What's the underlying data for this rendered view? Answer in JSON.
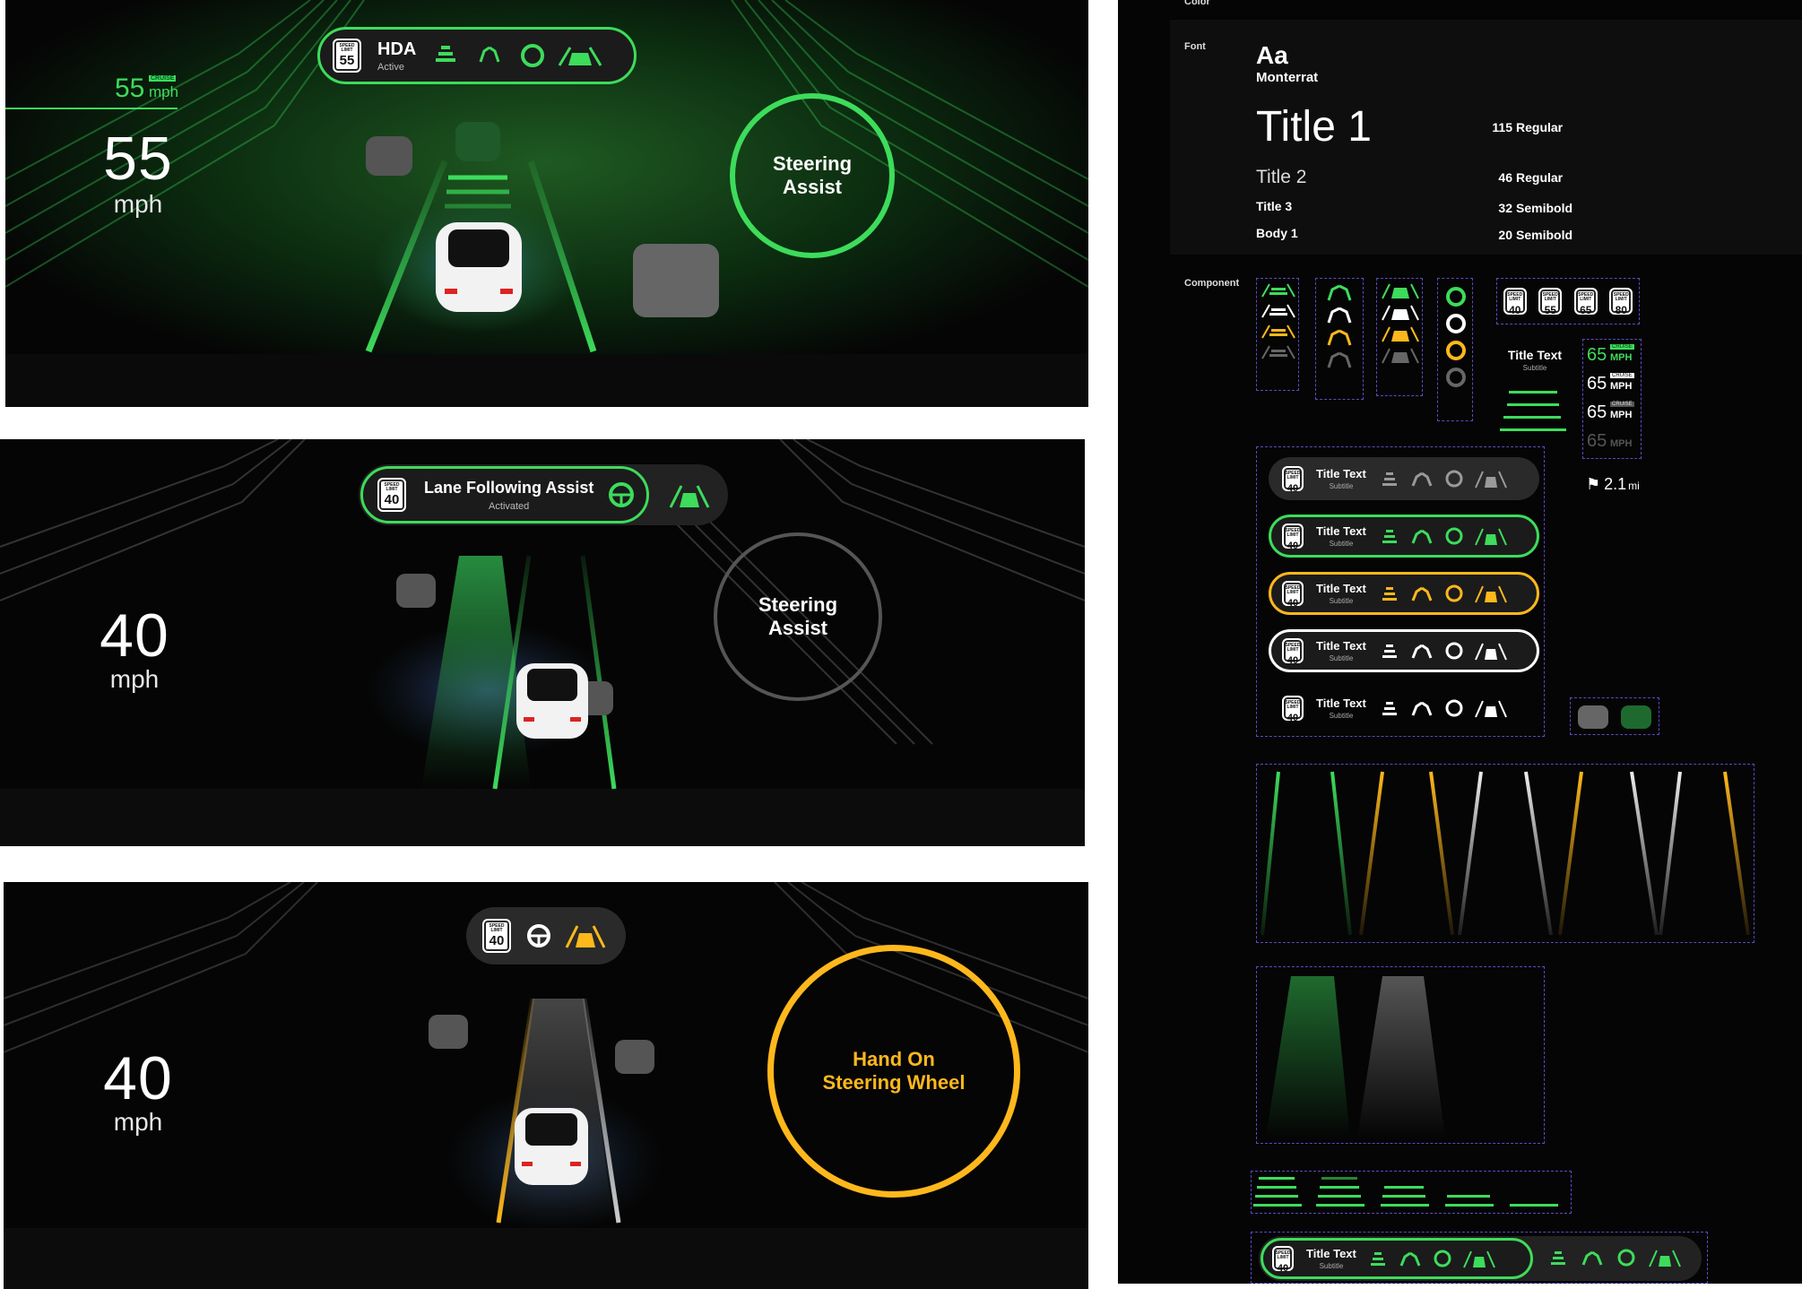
{
  "panel1": {
    "cruise_value": "55",
    "cruise_badge": "CRUISE",
    "cruise_unit": "mph",
    "speed": "55",
    "unit": "mph",
    "hda_title": "HDA",
    "hda_subtitle": "Active",
    "limit_label": "SPEED LIMIT",
    "limit": "55",
    "assist_line1": "Steering",
    "assist_line2": "Assist",
    "accent": "#3ddc5b"
  },
  "panel2": {
    "speed": "40",
    "unit": "mph",
    "limit_label": "SPEED LIMIT",
    "limit": "40",
    "pill_title": "Lane Following Assist",
    "pill_subtitle": "Activated",
    "assist_line1": "Steering",
    "assist_line2": "Assist",
    "accent": "#3ddc5b",
    "ring": "#555555"
  },
  "panel3": {
    "speed": "40",
    "unit": "mph",
    "limit_label": "SPEED LIMIT",
    "limit": "40",
    "warn_line1": "Hand On",
    "warn_line2": "Steering Wheel",
    "warn_color": "#ffb81c"
  },
  "guide": {
    "color_label": "Color",
    "font_label": "Font",
    "font_sample": "Aa",
    "font_name": "Monterrat",
    "type_scale": [
      {
        "name": "Title 1",
        "size": "115",
        "weight": "Regular"
      },
      {
        "name": "Title 2",
        "size": "46",
        "weight": "Regular"
      },
      {
        "name": "Title 3",
        "size": "32",
        "weight": "Semibold"
      },
      {
        "name": "Body 1",
        "size": "20",
        "weight": "Semibold"
      }
    ],
    "component_label": "Component",
    "signs": [
      "40",
      "55",
      "65",
      "80"
    ],
    "sign_label": "SPEED LIMIT",
    "title_text": "Title Text",
    "subtitle_text": "Subtitle",
    "speed_rows": [
      {
        "value": "65",
        "unit": "MPH",
        "badge": "CRUISE"
      },
      {
        "value": "65",
        "unit": "MPH",
        "badge": "CRUISE"
      },
      {
        "value": "65",
        "unit": "MPH",
        "badge": "CRUISE"
      },
      {
        "value": "65",
        "unit": "MPH",
        "badge": ""
      }
    ],
    "distance": "2.1",
    "distance_unit": "mi",
    "pill_limit": "40",
    "pills": [
      {
        "title": "Title Text",
        "subtitle": "Subtitle",
        "color": "#9a9a9a",
        "border": "none"
      },
      {
        "title": "Title Text",
        "subtitle": "Subtitle",
        "color": "#3ddc5b",
        "border": "#3ddc5b"
      },
      {
        "title": "Title Text",
        "subtitle": "Subtitle",
        "color": "#ffb81c",
        "border": "#ffb81c"
      },
      {
        "title": "Title Text",
        "subtitle": "Subtitle",
        "color": "#ffffff",
        "border": "#ffffff"
      },
      {
        "title": "Title Text",
        "subtitle": "Subtitle",
        "color": "#ffffff",
        "border": "transparent"
      }
    ],
    "bottom_pill_title": "Title Text",
    "bottom_pill_subtitle": "Subtitle",
    "colors": {
      "green": "#3ddc5b",
      "yellow": "#ffb81c",
      "blue": "#3aa0ff",
      "white": "#ffffff",
      "gray": "#555555"
    }
  }
}
